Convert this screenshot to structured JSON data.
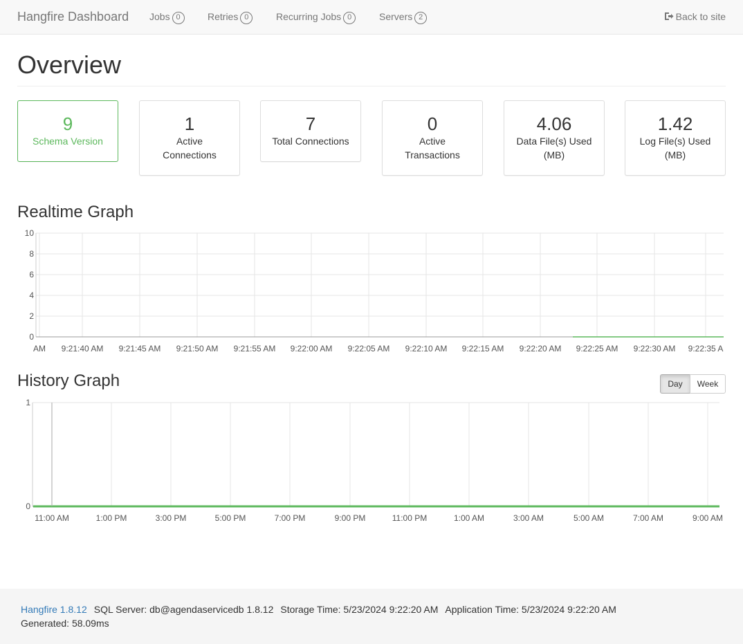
{
  "navbar": {
    "brand": "Hangfire Dashboard",
    "items": [
      {
        "label": "Jobs",
        "count": "0"
      },
      {
        "label": "Retries",
        "count": "0"
      },
      {
        "label": "Recurring Jobs",
        "count": "0"
      },
      {
        "label": "Servers",
        "count": "2"
      }
    ],
    "back_label": "Back to site"
  },
  "page": {
    "title": "Overview"
  },
  "metrics": [
    {
      "value": "9",
      "label": "Schema Version"
    },
    {
      "value": "1",
      "label": "Active Connections"
    },
    {
      "value": "7",
      "label": "Total Connections"
    },
    {
      "value": "0",
      "label": "Active Transactions"
    },
    {
      "value": "4.06",
      "label": "Data File(s) Used (MB)"
    },
    {
      "value": "1.42",
      "label": "Log File(s) Used (MB)"
    }
  ],
  "realtime": {
    "title": "Realtime Graph",
    "chart_data": {
      "type": "line",
      "x": [
        "AM",
        "9:21:40 AM",
        "9:21:45 AM",
        "9:21:50 AM",
        "9:21:55 AM",
        "9:22:00 AM",
        "9:22:05 AM",
        "9:22:10 AM",
        "9:22:15 AM",
        "9:22:20 AM",
        "9:22:25 AM",
        "9:22:30 AM",
        "9:22:35 A"
      ],
      "y_ticks": [
        "10",
        "8",
        "6",
        "4",
        "2",
        "0"
      ],
      "ylim": [
        0,
        10
      ],
      "series": [
        {
          "values": [
            0,
            0,
            0
          ]
        }
      ],
      "series_color": "#5cb85c",
      "grid": true
    }
  },
  "history": {
    "title": "History Graph",
    "buttons": {
      "day": "Day",
      "week": "Week"
    },
    "chart_data": {
      "type": "line",
      "x": [
        "11:00 AM",
        "1:00 PM",
        "3:00 PM",
        "5:00 PM",
        "7:00 PM",
        "9:00 PM",
        "11:00 PM",
        "1:00 AM",
        "3:00 AM",
        "5:00 AM",
        "7:00 AM",
        "9:00 AM"
      ],
      "y_ticks": [
        "1",
        "0"
      ],
      "ylim": [
        0,
        1
      ],
      "series": [
        {
          "values": [
            0,
            0,
            0,
            0,
            0,
            0,
            0,
            0,
            0,
            0,
            0,
            0
          ]
        }
      ],
      "series_color": "#5cb85c",
      "grid": true
    }
  },
  "footer": {
    "version": "Hangfire 1.8.12",
    "sql_server": "SQL Server: db@agendaservicedb 1.8.12",
    "storage_time": "Storage Time: 5/23/2024 9:22:20 AM",
    "app_time": "Application Time: 5/23/2024 9:22:20 AM",
    "generated": "Generated: 58.09ms"
  }
}
